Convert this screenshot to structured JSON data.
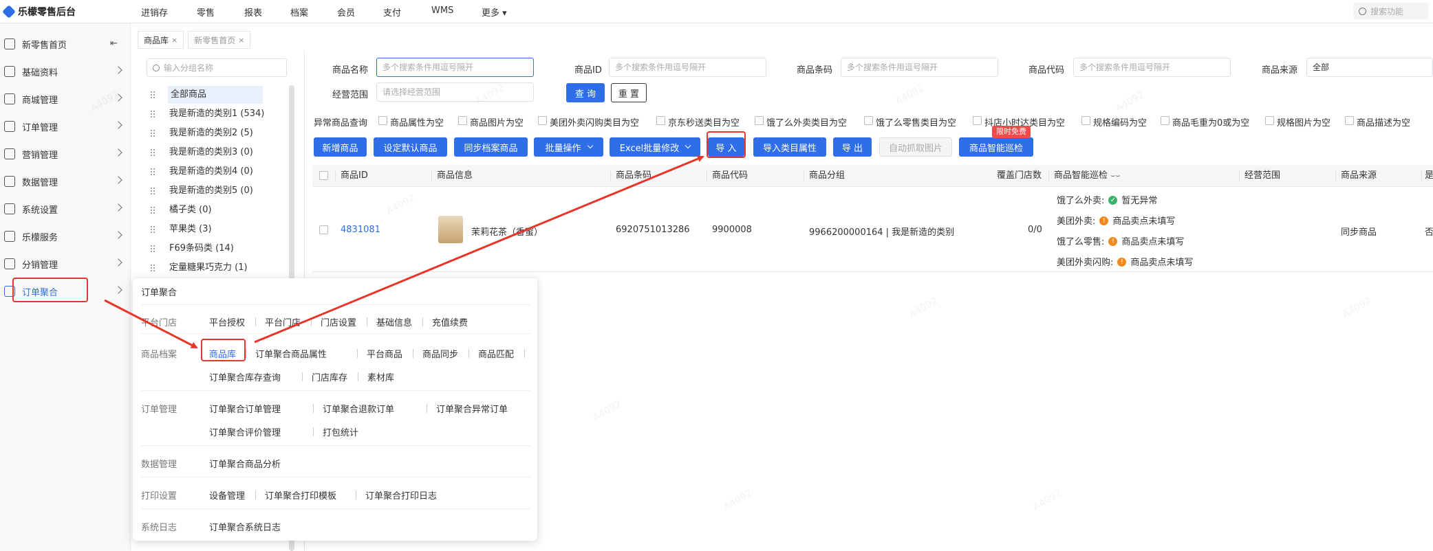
{
  "app": {
    "title": "乐檬零售后台"
  },
  "topnav": [
    "进销存",
    "零售",
    "报表",
    "档案",
    "会员",
    "支付",
    "WMS",
    "更多"
  ],
  "search": {
    "placeholder": "搜索功能"
  },
  "sidebar": {
    "items": [
      {
        "label": "新零售首页"
      },
      {
        "label": "基础资料"
      },
      {
        "label": "商城管理"
      },
      {
        "label": "订单管理"
      },
      {
        "label": "营销管理"
      },
      {
        "label": "数据管理"
      },
      {
        "label": "系统设置"
      },
      {
        "label": "乐檬服务"
      },
      {
        "label": "分销管理"
      },
      {
        "label": "订单聚合"
      }
    ],
    "active_index": 9
  },
  "tabs": [
    {
      "label": "商品库",
      "close": "×"
    },
    {
      "label": "新零售首页",
      "close": "×"
    }
  ],
  "tree": {
    "search_placeholder": "输入分组名称",
    "items": [
      "全部商品",
      "我是新造的类别1 (534)",
      "我是新造的类别2 (5)",
      "我是新造的类别3 (0)",
      "我是新造的类别4 (0)",
      "我是新造的类别5 (0)",
      "橘子类 (0)",
      "苹果类 (3)",
      "F69条码类 (14)",
      "定量糖果巧克力 (1)"
    ]
  },
  "filters": {
    "name_label": "商品名称",
    "name_placeholder": "多个搜索条件用逗号隔开",
    "id_label": "商品ID",
    "id_placeholder": "多个搜索条件用逗号隔开",
    "barcode_label": "商品条码",
    "barcode_placeholder": "多个搜索条件用逗号隔开",
    "code_label": "商品代码",
    "code_placeholder": "多个搜索条件用逗号隔开",
    "source_label": "商品来源",
    "source_value": "全部",
    "scope_label": "经营范围",
    "scope_placeholder": "请选择经营范围",
    "query_btn": "查 询",
    "reset_btn": "重 置"
  },
  "exceptions": {
    "label": "异常商品查询",
    "options": [
      "商品属性为空",
      "商品图片为空",
      "美团外卖闪购类目为空",
      "京东秒送类目为空",
      "饿了么外卖类目为空",
      "饿了么零售类目为空",
      "抖店小时达类目为空",
      "规格编码为空",
      "商品毛重为0或为空",
      "规格图片为空",
      "商品描述为空"
    ]
  },
  "toolbar": {
    "new": "新增商品",
    "set_default": "设定默认商品",
    "sync_archive": "同步档案商品",
    "batch": "批量操作",
    "excel": "Excel批量修改",
    "import": "导 入",
    "import_attr": "导入类目属性",
    "export": "导 出",
    "auto_fetch": "自动抓取图片",
    "inspect": "商品智能巡检",
    "free_tag": "限时免费"
  },
  "table": {
    "headers": [
      "商品ID",
      "商品信息",
      "商品条码",
      "商品代码",
      "商品分组",
      "覆盖门店数",
      "商品智能巡检",
      "经营范围",
      "商品来源",
      "是"
    ],
    "row": {
      "id": "4831081",
      "name": "茉莉花茶（香蜜）",
      "barcode": "6920751013286",
      "code": "9900008",
      "group": "9966200000164 | 我是新造的类别",
      "stores": "0/0",
      "inspect": [
        {
          "platform": "饿了么外卖:",
          "status": "暂无异常",
          "level": "ok"
        },
        {
          "platform": "美团外卖:",
          "status": "商品卖点未填写",
          "level": "warn"
        },
        {
          "platform": "饿了么零售:",
          "status": "商品卖点未填写",
          "level": "warn"
        },
        {
          "platform": "美团外卖闪购:",
          "status": "商品卖点未填写",
          "level": "warn"
        }
      ],
      "source": "同步商品",
      "extra": "否"
    }
  },
  "popup": {
    "title": "订单聚合",
    "sections": [
      {
        "label": "平台门店",
        "links": [
          "平台授权",
          "平台门店",
          "门店设置",
          "基础信息",
          "充值续费"
        ]
      },
      {
        "label": "商品档案",
        "links": [
          "商品库",
          "订单聚合商品属性",
          "平台商品",
          "商品同步",
          "商品匹配",
          "订单聚合库存查询",
          "门店库存",
          "素材库"
        ]
      },
      {
        "label": "订单管理",
        "links": [
          "订单聚合订单管理",
          "订单聚合退款订单",
          "订单聚合异常订单",
          "订单聚合评价管理",
          "打包统计"
        ]
      },
      {
        "label": "数据管理",
        "links": [
          "订单聚合商品分析"
        ]
      },
      {
        "label": "打印设置",
        "links": [
          "设备管理",
          "订单聚合打印模板",
          "订单聚合打印日志"
        ]
      },
      {
        "label": "系统日志",
        "links": [
          "订单聚合系统日志"
        ]
      }
    ]
  },
  "colors": {
    "primary": "#2f6ee8",
    "annotation": "#e8352a",
    "ok": "#3bb26a",
    "warn": "#f2891e"
  },
  "watermark": "A4092"
}
